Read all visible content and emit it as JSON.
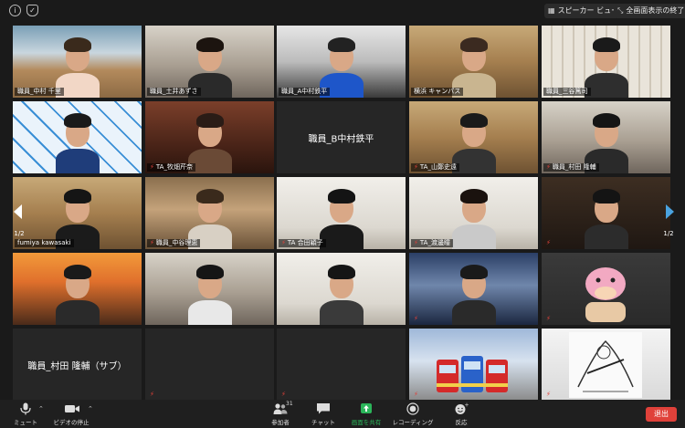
{
  "topbar": {
    "speaker_view": "スピーカー ビュー",
    "exit_fullscreen": "全画面表示の終了"
  },
  "pagination": {
    "left": "1/2",
    "right": "1/2"
  },
  "participants": [
    {
      "name": "職員_中村 千里",
      "muted": false,
      "video": true,
      "scene": "office",
      "hair": "#3a2a1c",
      "shirt": "#f2d7c6"
    },
    {
      "name": "職員_土井あずさ",
      "muted": false,
      "video": true,
      "scene": "room",
      "hair": "#1c140f",
      "shirt": "#2a2a2a"
    },
    {
      "name": "職員_A中村鉄平",
      "muted": false,
      "video": true,
      "scene": "studio",
      "hair": "#222",
      "shirt": "#1e56c9"
    },
    {
      "name": "横浜 キャンパス",
      "muted": false,
      "video": true,
      "scene": "cafe",
      "hair": "#3b2a20",
      "shirt": "#c9b590"
    },
    {
      "name": "職員_三谷篤司",
      "muted": false,
      "video": true,
      "scene": "tiles",
      "hair": "#1a1a1a",
      "shirt": "#2e2e2e"
    },
    {
      "name": "",
      "muted": false,
      "video": true,
      "scene": "backdrop",
      "hair": "#1a1a1a",
      "shirt": "#1f3d7a"
    },
    {
      "name": "TA_牧畑芹奈",
      "muted": true,
      "video": true,
      "scene": "graffiti",
      "hair": "#2a1c16",
      "shirt": "#6a4a36"
    },
    {
      "name": "職員_B中村鉄平",
      "muted": false,
      "video": false,
      "scene": "",
      "hair": "",
      "shirt": ""
    },
    {
      "name": "TA_山鄭史遠",
      "muted": true,
      "video": true,
      "scene": "cafe",
      "hair": "#1a1a1a",
      "shirt": "#333"
    },
    {
      "name": "職員_村田 隆輔",
      "muted": true,
      "video": true,
      "scene": "room",
      "hair": "#151515",
      "shirt": "#2a2a2a"
    },
    {
      "name": "fumiya kawasaki",
      "muted": false,
      "video": true,
      "scene": "cafe",
      "hair": "#151515",
      "shirt": "#1b1b1b"
    },
    {
      "name": "職員_中谷理恵",
      "muted": true,
      "video": true,
      "scene": "shop",
      "hair": "#3a2a1c",
      "shirt": "#d8d0c4"
    },
    {
      "name": "TA 合田穎子",
      "muted": true,
      "video": true,
      "scene": "plain",
      "hair": "#141414",
      "shirt": "#1a1a1a"
    },
    {
      "name": "TA_渡邊瞳",
      "muted": true,
      "video": true,
      "scene": "plain",
      "hair": "#1a120e",
      "shirt": "#c9c9c9"
    },
    {
      "name": "",
      "muted": true,
      "video": true,
      "scene": "dark",
      "hair": "#141414",
      "shirt": "#2c2c2c"
    },
    {
      "name": "",
      "muted": false,
      "video": true,
      "scene": "sunset",
      "hair": "#1a1a1a",
      "shirt": "#2a2a2a"
    },
    {
      "name": "",
      "muted": false,
      "video": true,
      "scene": "room",
      "hair": "#151515",
      "shirt": "#e8e8e8"
    },
    {
      "name": "",
      "muted": false,
      "video": true,
      "scene": "plain",
      "hair": "#151515",
      "shirt": "#3a3a3a"
    },
    {
      "name": "",
      "muted": true,
      "video": true,
      "scene": "storm",
      "hair": "#1a1a1a",
      "shirt": "#2a2a2a"
    },
    {
      "name": "",
      "muted": true,
      "video": true,
      "scene": "plush",
      "hair": "",
      "shirt": ""
    },
    {
      "name": "職員_村田 隆輔（サブ）",
      "muted": false,
      "video": false,
      "scene": "",
      "hair": "",
      "shirt": ""
    },
    {
      "name": "",
      "muted": true,
      "video": false,
      "scene": "",
      "hair": "",
      "shirt": ""
    },
    {
      "name": "",
      "muted": true,
      "video": false,
      "scene": "",
      "hair": "",
      "shirt": ""
    },
    {
      "name": "",
      "muted": true,
      "video": true,
      "scene": "trains",
      "hair": "",
      "shirt": ""
    },
    {
      "name": "",
      "muted": true,
      "video": true,
      "scene": "sketch",
      "hair": "",
      "shirt": ""
    }
  ],
  "toolbar": {
    "mute": "ミュート",
    "stop_video": "ビデオの停止",
    "participants": "参加者",
    "participants_count": "31",
    "chat": "チャット",
    "share_screen": "画面を共有",
    "recording": "レコーディング",
    "reactions": "反応",
    "leave": "退出"
  },
  "colors": {
    "leave": "#e0413a",
    "share": "#2bb55a",
    "mute_icon": "#e0413a",
    "nav_arrow": "#4aa3e0"
  }
}
